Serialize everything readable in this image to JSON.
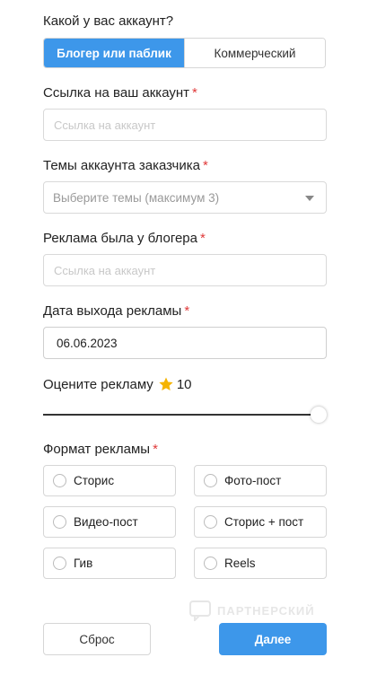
{
  "account_type": {
    "label": "Какой у вас аккаунт?",
    "options": [
      "Блогер или паблик",
      "Коммерческий"
    ],
    "selected": "Блогер или паблик"
  },
  "account_link": {
    "label": "Ссылка на ваш аккаунт",
    "required_mark": "*",
    "placeholder": "Ссылка на аккаунт",
    "value": ""
  },
  "account_topics": {
    "label": "Темы аккаунта заказчика",
    "required_mark": "*",
    "placeholder": "Выберите темы (максимум 3)"
  },
  "blogger_ad": {
    "label": "Реклама была у блогера",
    "required_mark": "*",
    "placeholder": "Ссылка на аккаунт",
    "value": ""
  },
  "ad_date": {
    "label": "Дата выхода рекламы",
    "required_mark": "*",
    "value": "06.06.2023"
  },
  "rating": {
    "label": "Оцените рекламу",
    "icon": "star-icon",
    "value": "10",
    "max": 10,
    "level": 1.0,
    "accent_color": "#f5b400"
  },
  "ad_format": {
    "label": "Формат рекламы",
    "required_mark": "*",
    "options": [
      "Сторис",
      "Фото-пост",
      "Видео-пост",
      "Сторис + пост",
      "Гив",
      "Reels"
    ]
  },
  "watermark": {
    "text": "ПАРТНЕРСКИЙ"
  },
  "buttons": {
    "reset": "Сброс",
    "next": "Далее"
  },
  "colors": {
    "primary": "#3d97ea",
    "required": "#e03a3a"
  }
}
